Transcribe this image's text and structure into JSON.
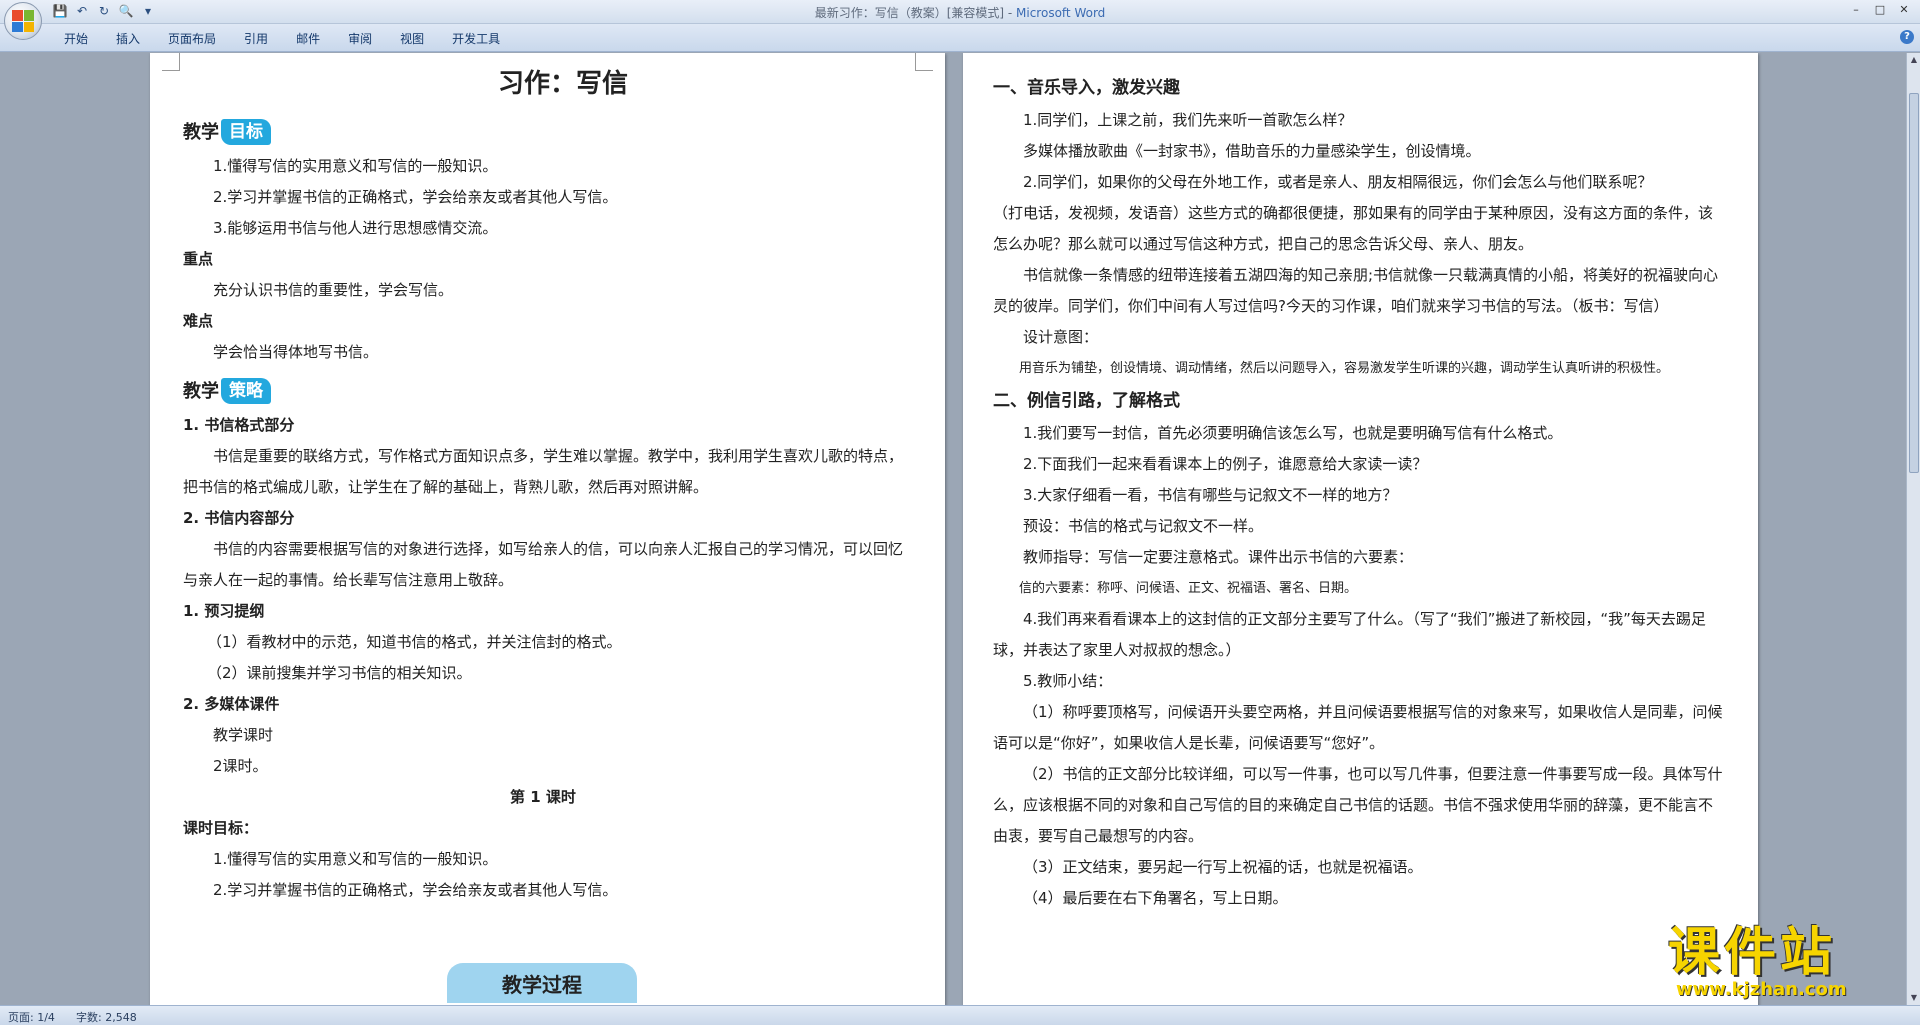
{
  "window": {
    "title": "最新习作：写信（教案）[兼容模式] - ",
    "app_name": "Microsoft Word",
    "controls": [
      "–",
      "□",
      "✕"
    ]
  },
  "ribbon": {
    "tabs": [
      "开始",
      "插入",
      "页面布局",
      "引用",
      "邮件",
      "审阅",
      "视图",
      "开发工具"
    ]
  },
  "left_page": {
    "title": "习作：写信",
    "goal_head": {
      "a": "教学",
      "b": "目标"
    },
    "goals": [
      "1.懂得写信的实用意义和写信的一般知识。",
      "2.学习并掌握书信的正确格式，学会给亲友或者其他人写信。",
      "3.能够运用书信与他人进行思想感情交流。"
    ],
    "key_label": "重点",
    "key_text": "充分认识书信的重要性，学会写信。",
    "diff_label": "难点",
    "diff_text": "学会恰当得体地写书信。",
    "strategy_head": {
      "a": "教学",
      "b": "策略"
    },
    "s1_title": "1. 书信格式部分",
    "s1_text": "书信是重要的联络方式，写作格式方面知识点多，学生难以掌握。教学中，我利用学生喜欢儿歌的特点，把书信的格式编成儿歌，让学生在了解的基础上，背熟儿歌，然后再对照讲解。",
    "s2_title": "2. 书信内容部分",
    "s2_text": "书信的内容需要根据写信的对象进行选择，如写给亲人的信，可以向亲人汇报自己的学习情况，可以回忆与亲人在一起的事情。给长辈写信注意用上敬辞。",
    "p1_title": "1. 预习提纲",
    "p1_items": [
      "（1）看教材中的示范，知道书信的格式，并关注信封的格式。",
      "（2）课前搜集并学习书信的相关知识。"
    ],
    "p2_title": "2. 多媒体课件",
    "p2_items": [
      "教学课时",
      "2课时。"
    ],
    "lesson_title": "第 1 课时",
    "lesson_goal_label": "课时目标：",
    "lesson_goals": [
      "1.懂得写信的实用意义和写信的一般知识。",
      "2.学习并掌握书信的正确格式，学会给亲友或者其他人写信。"
    ],
    "banner": "教学过程"
  },
  "right_page": {
    "h1": "一、音乐导入，激发兴趣",
    "lines1": [
      "1.同学们，上课之前，我们先来听一首歌怎么样？",
      "多媒体播放歌曲《一封家书》，借助音乐的力量感染学生，创设情境。",
      "2.同学们，如果你的父母在外地工作，或者是亲人、朋友相隔很远，你们会怎么与他们联系呢？"
    ],
    "para1": "（打电话，发视频，发语音）这些方式的确都很便捷，那如果有的同学由于某种原因，没有这方面的条件，该怎么办呢？那么就可以通过写信这种方式，把自己的思念告诉父母、亲人、朋友。",
    "para2": "书信就像一条情感的纽带连接着五湖四海的知己亲朋;书信就像一只载满真情的小船，将美好的祝福驶向心灵的彼岸。同学们，你们中间有人写过信吗?今天的习作课，咱们就来学习书信的写法。（板书：写信）",
    "design_label": "设计意图：",
    "design_text": "用音乐为铺垫，创设情境、调动情绪，然后以问题导入，容易激发学生听课的兴趣，调动学生认真听讲的积极性。",
    "h2": "二、例信引路，了解格式",
    "lines2": [
      "1.我们要写一封信，首先必须要明确信该怎么写，也就是要明确写信有什么格式。",
      "2.下面我们一起来看看课本上的例子，谁愿意给大家读一读？",
      "3.大家仔细看一看，书信有哪些与记叙文不一样的地方？",
      "预设：书信的格式与记叙文不一样。",
      "教师指导：写信一定要注意格式。课件出示书信的六要素："
    ],
    "six_elements": "信的六要素：称呼、问候语、正文、祝福语、署名、日期。",
    "para3": "4.我们再来看看课本上的这封信的正文部分主要写了什么。（写了“我们”搬进了新校园，“我”每天去踢足球，并表达了家里人对叔叔的想念。）",
    "summary_label": "5.教师小结：",
    "summary1": "（1）称呼要顶格写，问候语开头要空两格，并且问候语要根据写信的对象来写，如果收信人是同辈，问候语可以是“你好”，如果收信人是长辈，问候语要写“您好”。",
    "summary2": "（2）书信的正文部分比较详细，可以写一件事，也可以写几件事，但要注意一件事要写成一段。具体写什么，应该根据不同的对象和自己写信的目的来确定自己书信的话题。书信不强求使用华丽的辞藻，更不能言不由衷，要写自己最想写的内容。",
    "summary3": "（3）正文结束，要另起一行写上祝福的话，也就是祝福语。",
    "summary4": "（4）最后要在右下角署名，写上日期。"
  },
  "status": {
    "page": "页面: 1/4",
    "words": "字数: 2,548"
  },
  "watermark": {
    "main": "课件站",
    "url": "www.kjzhan.com"
  },
  "colors": {
    "accent": "#23a8de",
    "watermark": "#f6d400"
  }
}
